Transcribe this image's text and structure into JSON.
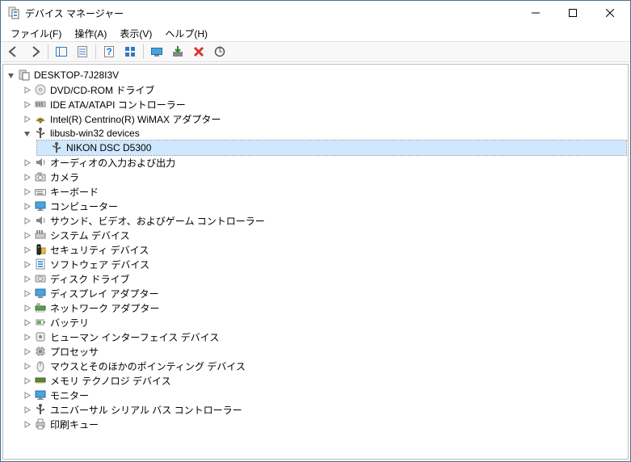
{
  "window": {
    "title": "デバイス マネージャー"
  },
  "menu": {
    "file": "ファイル(F)",
    "action": "操作(A)",
    "view": "表示(V)",
    "help": "ヘルプ(H)"
  },
  "tree": {
    "root": {
      "label": "DESKTOP-7J28I3V",
      "expanded": true,
      "icon": "computer"
    },
    "nodes": [
      {
        "label": "DVD/CD-ROM ドライブ",
        "icon": "disc",
        "expanded": false
      },
      {
        "label": "IDE ATA/ATAPI コントローラー",
        "icon": "ide",
        "expanded": false
      },
      {
        "label": "Intel(R) Centrino(R) WiMAX アダプター",
        "icon": "wimax",
        "expanded": false
      },
      {
        "label": "libusb-win32 devices",
        "icon": "usb",
        "expanded": true,
        "children": [
          {
            "label": "NIKON DSC D5300",
            "icon": "usb",
            "selected": true
          }
        ]
      },
      {
        "label": "オーディオの入力および出力",
        "icon": "audio",
        "expanded": false
      },
      {
        "label": "カメラ",
        "icon": "camera",
        "expanded": false
      },
      {
        "label": "キーボード",
        "icon": "keyboard",
        "expanded": false
      },
      {
        "label": "コンピューター",
        "icon": "monitor",
        "expanded": false
      },
      {
        "label": "サウンド、ビデオ、およびゲーム コントローラー",
        "icon": "audio",
        "expanded": false
      },
      {
        "label": "システム デバイス",
        "icon": "system",
        "expanded": false
      },
      {
        "label": "セキュリティ デバイス",
        "icon": "security",
        "expanded": false
      },
      {
        "label": "ソフトウェア デバイス",
        "icon": "software",
        "expanded": false
      },
      {
        "label": "ディスク ドライブ",
        "icon": "disk",
        "expanded": false
      },
      {
        "label": "ディスプレイ アダプター",
        "icon": "display",
        "expanded": false
      },
      {
        "label": "ネットワーク アダプター",
        "icon": "network",
        "expanded": false
      },
      {
        "label": "バッテリ",
        "icon": "battery",
        "expanded": false
      },
      {
        "label": "ヒューマン インターフェイス デバイス",
        "icon": "hid",
        "expanded": false
      },
      {
        "label": "プロセッサ",
        "icon": "cpu",
        "expanded": false
      },
      {
        "label": "マウスとそのほかのポインティング デバイス",
        "icon": "mouse",
        "expanded": false
      },
      {
        "label": "メモリ テクノロジ デバイス",
        "icon": "memory",
        "expanded": false
      },
      {
        "label": "モニター",
        "icon": "monitor",
        "expanded": false
      },
      {
        "label": "ユニバーサル シリアル バス コントローラー",
        "icon": "usb",
        "expanded": false
      },
      {
        "label": "印刷キュー",
        "icon": "printer",
        "expanded": false
      }
    ]
  }
}
